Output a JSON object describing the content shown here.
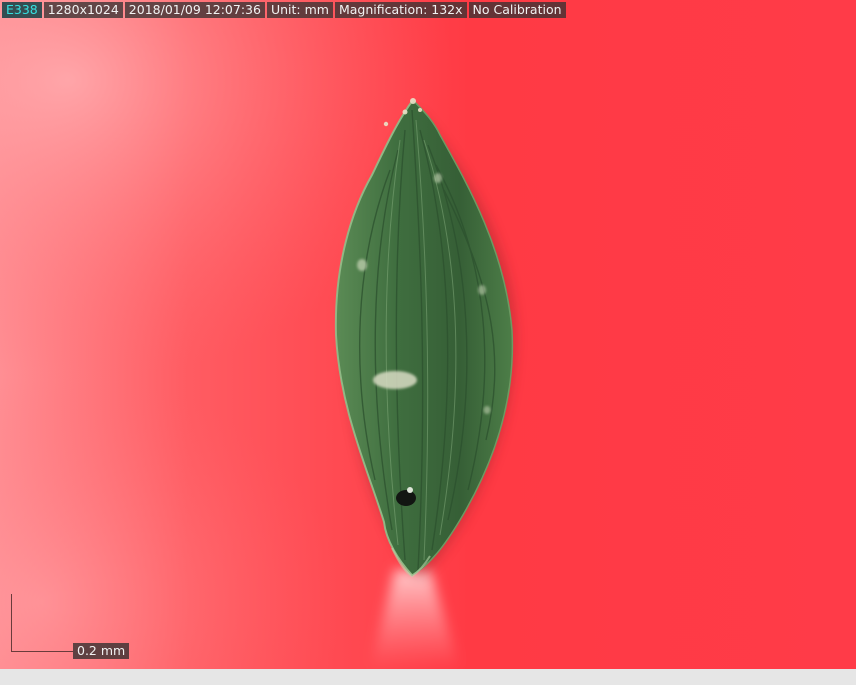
{
  "overlay": {
    "camera_id": "E338",
    "resolution": "1280x1024",
    "datetime": "2018/01/09 12:07:36",
    "unit": "Unit: mm",
    "magnification": "Magnification:  132x",
    "calibration": "No Calibration"
  },
  "scale_bar": {
    "label": "0.2 mm"
  },
  "colors": {
    "background_red": "#ff3c47",
    "specimen_green": "#3d6a3c",
    "id_text": "#35e0e0"
  },
  "specimen": {
    "subject": "green lanceolate leaf/seed specimen on red background"
  }
}
